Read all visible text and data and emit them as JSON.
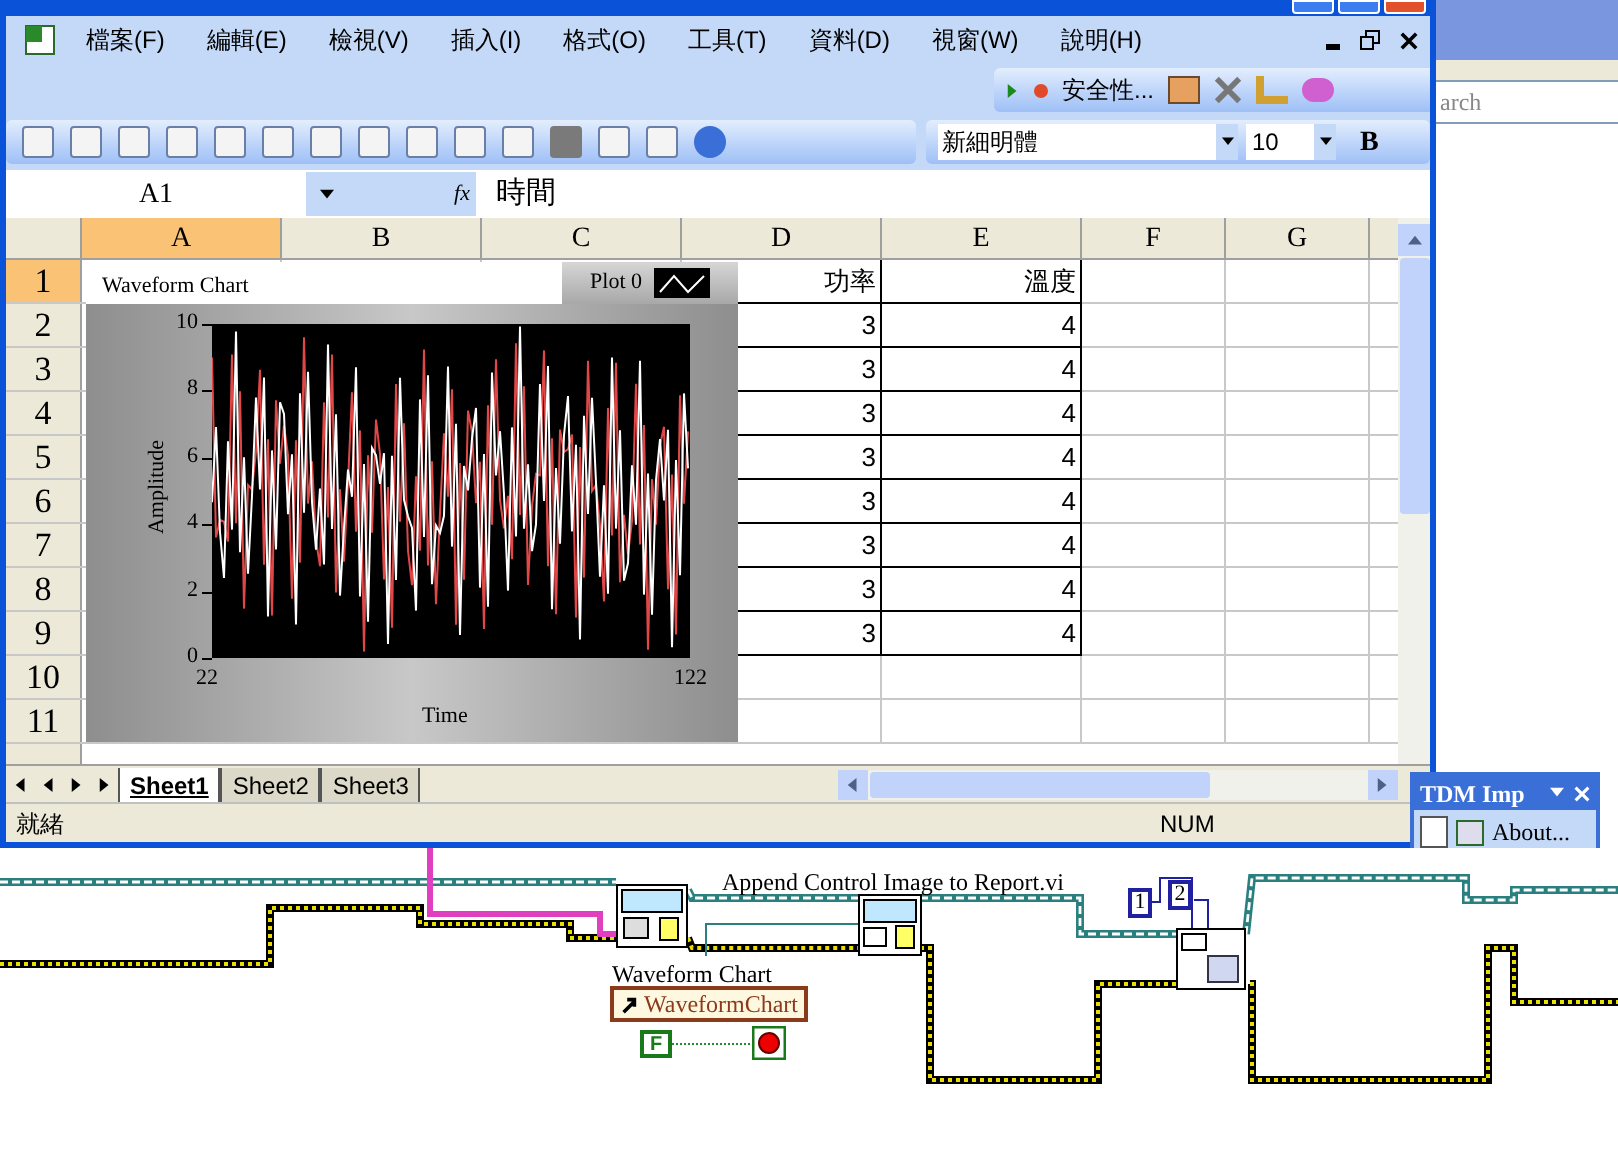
{
  "menu": [
    "檔案(F)",
    "編輯(E)",
    "檢視(V)",
    "插入(I)",
    "格式(O)",
    "工具(T)",
    "資料(D)",
    "視窗(W)",
    "說明(H)"
  ],
  "security_toolbar": {
    "label": "安全性..."
  },
  "format_toolbar": {
    "font": "新細明體",
    "size": "10",
    "bold": "B"
  },
  "formula_bar": {
    "name_box": "A1",
    "fx": "fx",
    "value": "時間"
  },
  "columns": [
    {
      "label": "A",
      "selected": true
    },
    {
      "label": "B",
      "selected": false
    },
    {
      "label": "C",
      "selected": false
    },
    {
      "label": "D",
      "selected": false
    },
    {
      "label": "E",
      "selected": false
    },
    {
      "label": "F",
      "selected": false
    },
    {
      "label": "G",
      "selected": false
    }
  ],
  "rows": [
    {
      "label": "1",
      "selected": true,
      "cells": [
        "",
        "",
        "",
        "功率",
        "溫度",
        "",
        ""
      ]
    },
    {
      "label": "2",
      "selected": false,
      "cells": [
        "",
        "",
        "",
        "3",
        "4",
        "",
        ""
      ]
    },
    {
      "label": "3",
      "selected": false,
      "cells": [
        "",
        "",
        "",
        "3",
        "4",
        "",
        ""
      ]
    },
    {
      "label": "4",
      "selected": false,
      "cells": [
        "",
        "",
        "",
        "3",
        "4",
        "",
        ""
      ]
    },
    {
      "label": "5",
      "selected": false,
      "cells": [
        "",
        "",
        "",
        "3",
        "4",
        "",
        ""
      ]
    },
    {
      "label": "6",
      "selected": false,
      "cells": [
        "",
        "",
        "",
        "3",
        "4",
        "",
        ""
      ]
    },
    {
      "label": "7",
      "selected": false,
      "cells": [
        "",
        "",
        "",
        "3",
        "4",
        "",
        ""
      ]
    },
    {
      "label": "8",
      "selected": false,
      "cells": [
        "",
        "",
        "",
        "3",
        "4",
        "",
        ""
      ]
    },
    {
      "label": "9",
      "selected": false,
      "cells": [
        "",
        "",
        "",
        "3",
        "4",
        "",
        ""
      ]
    },
    {
      "label": "10",
      "selected": false,
      "cells": [
        "",
        "",
        "",
        "",
        "",
        "",
        ""
      ]
    },
    {
      "label": "11",
      "selected": false,
      "cells": [
        "",
        "",
        "",
        "",
        "",
        "",
        ""
      ]
    }
  ],
  "chart": {
    "title": "Waveform Chart",
    "legend": "Plot 0",
    "ylabel": "Amplitude",
    "xlabel": "Time",
    "yticks": [
      "10",
      "8",
      "6",
      "4",
      "2",
      "0"
    ],
    "xticks": [
      "22",
      "122"
    ]
  },
  "sheet_tabs": [
    {
      "label": "Sheet1",
      "selected": true
    },
    {
      "label": "Sheet2",
      "selected": false
    },
    {
      "label": "Sheet3",
      "selected": false
    }
  ],
  "status_bar": {
    "text": "就緒",
    "indicator": "NUM"
  },
  "side_window": {
    "search_placeholder": "arch"
  },
  "tdm_toolbar": {
    "title": "TDM Imp",
    "about": "About..."
  },
  "diagram": {
    "vi_label": "Append Control Image to Report.vi",
    "control_label": "Waveform Chart",
    "reference": "WaveformChart",
    "bool_constant": "F",
    "constants": [
      "1",
      "2"
    ]
  }
}
